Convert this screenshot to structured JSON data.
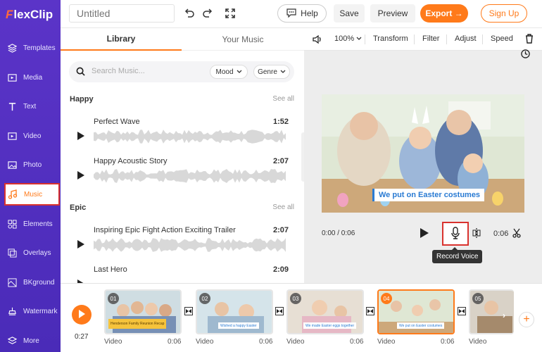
{
  "app": {
    "logo_text": "lexClip",
    "logo_initial": "F"
  },
  "sidebar": {
    "items": [
      {
        "label": "Templates",
        "icon": "layers-icon"
      },
      {
        "label": "Media",
        "icon": "media-icon"
      },
      {
        "label": "Text",
        "icon": "text-icon"
      },
      {
        "label": "Video",
        "icon": "video-icon"
      },
      {
        "label": "Photo",
        "icon": "photo-icon"
      },
      {
        "label": "Music",
        "icon": "music-icon"
      },
      {
        "label": "Elements",
        "icon": "elements-icon"
      },
      {
        "label": "Overlays",
        "icon": "overlays-icon"
      },
      {
        "label": "BKground",
        "icon": "background-icon"
      },
      {
        "label": "Watermark",
        "icon": "watermark-icon"
      },
      {
        "label": "More",
        "icon": "more-icon"
      }
    ],
    "active_index": 5
  },
  "topbar": {
    "title_placeholder": "Untitled",
    "help_label": "Help",
    "save_label": "Save",
    "preview_label": "Preview",
    "export_label": "Export →",
    "signup_label": "Sign Up"
  },
  "library": {
    "tabs": [
      "Library",
      "Your Music"
    ],
    "search_placeholder": "Search Music...",
    "mood_label": "Mood",
    "genre_label": "Genre",
    "sections": [
      {
        "title": "Happy",
        "see_all": "See all",
        "tracks": [
          {
            "name": "Perfect Wave",
            "duration": "1:52"
          },
          {
            "name": "Happy Acoustic Story",
            "duration": "2:07"
          }
        ]
      },
      {
        "title": "Epic",
        "see_all": "See all",
        "tracks": [
          {
            "name": "Inspiring Epic Fight Action Exciting Trailer",
            "duration": "2:07"
          },
          {
            "name": "Last Hero",
            "duration": "2:09"
          }
        ]
      }
    ]
  },
  "editor": {
    "volume_level": "100%",
    "tools": [
      "Transform",
      "Filter",
      "Adjust",
      "Speed"
    ],
    "caption": "We put on Easter costumes",
    "time_display": "0:00 / 0:06",
    "clip_duration": "0:06",
    "tooltip": "Record Voice"
  },
  "timeline": {
    "current_time": "0:27",
    "clips": [
      {
        "num": "01",
        "label": "Video",
        "duration": "0:06",
        "caption": "Henderson Family Reunion Recap"
      },
      {
        "num": "02",
        "label": "Video",
        "duration": "0:06",
        "caption": "Wished a happy Easter"
      },
      {
        "num": "03",
        "label": "Video",
        "duration": "0:06",
        "caption": "We made Easter eggs together"
      },
      {
        "num": "04",
        "label": "Video",
        "duration": "0:06",
        "caption": "We put on Easter costumes"
      },
      {
        "num": "05",
        "label": "Video",
        "duration": "",
        "caption": ""
      }
    ],
    "selected_index": 3
  },
  "colors": {
    "accent": "#ff7a1a",
    "sidebar": "#5b34c8",
    "highlight": "#d9322e",
    "caption_blue": "#2a7bd3"
  }
}
